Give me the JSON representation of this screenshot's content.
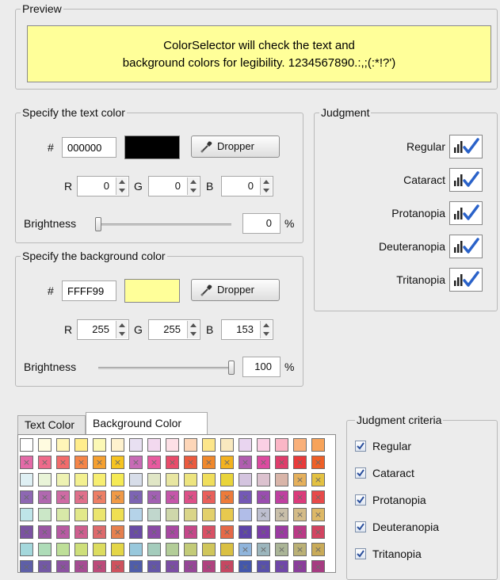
{
  "preview": {
    "legend": "Preview",
    "line1": "ColorSelector will check the text and",
    "line2": "background colors for legibility. 1234567890.:,;(:*!?')",
    "bg_color": "#FFFF99",
    "text_color": "#000000"
  },
  "text_color": {
    "legend": "Specify the text color",
    "hash_label": "#",
    "hex": "000000",
    "swatch": "#000000",
    "dropper_label": "Dropper",
    "r_label": "R",
    "r": "0",
    "g_label": "G",
    "g": "0",
    "b_label": "B",
    "b": "0",
    "brightness_label": "Brightness",
    "brightness": "0",
    "brightness_level": 0,
    "pct": "%"
  },
  "bg_color": {
    "legend": "Specify the background color",
    "hash_label": "#",
    "hex": "FFFF99",
    "swatch": "#FFFF99",
    "dropper_label": "Dropper",
    "r_label": "R",
    "r": "255",
    "g_label": "G",
    "g": "255",
    "b_label": "B",
    "b": "153",
    "brightness_label": "Brightness",
    "brightness": "100",
    "brightness_level": 100,
    "pct": "%"
  },
  "judgment": {
    "legend": "Judgment",
    "rows": [
      {
        "name": "Regular"
      },
      {
        "name": "Cataract"
      },
      {
        "name": "Protanopia"
      },
      {
        "name": "Deuteranopia"
      },
      {
        "name": "Tritanopia"
      }
    ],
    "check_color": "#2a62c9"
  },
  "tabs": {
    "text_color": "Text Color",
    "background_color": "Background Color",
    "active": "Background Color"
  },
  "palette": {
    "mark": "×",
    "rows": [
      [
        "#ffffff",
        "#fffbe0",
        "#fff5b8",
        "#ffed8c",
        "#fbf8b6",
        "#fef2ce",
        "#e8e0f2",
        "#f3d9ef",
        "#fde0e6",
        "#fdd6b8",
        "#fde68a",
        "#f9e9bf",
        "#e9d5f0",
        "#fad0e4",
        "#fbb6c6",
        "#f9b07a",
        "#f7a35a"
      ],
      [
        "#e46aa7",
        "#ef6a8b",
        "#f26b6b",
        "#f58548",
        "#f5a02f",
        "#f6c421",
        "#c86bb6",
        "#e85a9f",
        "#e94b6a",
        "#ec5a3e",
        "#f0882b",
        "#f3b21f",
        "#b15db0",
        "#dd4aa0",
        "#e03d6c",
        "#ea3a3a",
        "#ee5f27"
      ],
      [
        "#dff0f4",
        "#e9f4d8",
        "#eef2b2",
        "#f3f090",
        "#f7ee72",
        "#f5ea55",
        "#d7dde9",
        "#e0e6c6",
        "#e8e6a1",
        "#ede47f",
        "#f0de5c",
        "#e9d43a",
        "#d4c4df",
        "#dcc2cf",
        "#d9b5a9",
        "#e5b05c",
        "#e3c142"
      ],
      [
        "#8e67b3",
        "#b168b0",
        "#cf6ba4",
        "#e0708b",
        "#ee7f66",
        "#f19a45",
        "#7d64b4",
        "#a260b3",
        "#c656aa",
        "#de5088",
        "#ea5f5a",
        "#ee7b3a",
        "#7458b7",
        "#9a4db0",
        "#c040a1",
        "#dc3b7b",
        "#e84a4a"
      ],
      [
        "#bfe5e9",
        "#cbe7c7",
        "#d8e9a8",
        "#e2e88a",
        "#ebe56e",
        "#efdf52",
        "#b5d3e9",
        "#c1d7cd",
        "#cfd7aa",
        "#dad589",
        "#e3d06b",
        "#e8c94e",
        "#b1bde8",
        "#bdbfcf",
        "#c9bfa9",
        "#d4bb87",
        "#ddb866"
      ],
      [
        "#7b52a2",
        "#9a55a4",
        "#b85aa3",
        "#cf5e8f",
        "#de6a6c",
        "#e6804e",
        "#6a4ca6",
        "#8a4aa6",
        "#a948a3",
        "#c6478a",
        "#d95165",
        "#e56948",
        "#5d44a9",
        "#7c3ea8",
        "#9c3aa3",
        "#bb3a87",
        "#d24461"
      ],
      [
        "#a4d8dc",
        "#aedcb8",
        "#bedf98",
        "#cedf7a",
        "#dcdc5f",
        "#e4d647",
        "#98c8dc",
        "#a4ccbc",
        "#b3cd98",
        "#c3cb78",
        "#d0c65b",
        "#dac042",
        "#90b5dc",
        "#9cb6bd",
        "#abb597",
        "#bbb176",
        "#c9ab59"
      ],
      [
        "#5e5fa8",
        "#7358a5",
        "#8c52a1",
        "#a64c93",
        "#bd4b7a",
        "#cf525e",
        "#4f5daa",
        "#6456a8",
        "#7c4ea5",
        "#974698",
        "#b1427f",
        "#c64762",
        "#4357ac",
        "#5850ab",
        "#7047a9",
        "#8b3e9c",
        "#a73b82"
      ]
    ],
    "marked_rows": [
      1,
      3,
      5,
      7
    ],
    "partial_marks": {
      "2": [
        15,
        16
      ],
      "4": [
        13,
        14,
        15,
        16
      ],
      "6": [
        12,
        13,
        14,
        15,
        16
      ]
    }
  },
  "criteria": {
    "legend": "Judgment criteria",
    "items": [
      "Regular",
      "Cataract",
      "Protanopia",
      "Deuteranopia",
      "Tritanopia"
    ],
    "checked": [
      true,
      true,
      true,
      true,
      true
    ]
  }
}
